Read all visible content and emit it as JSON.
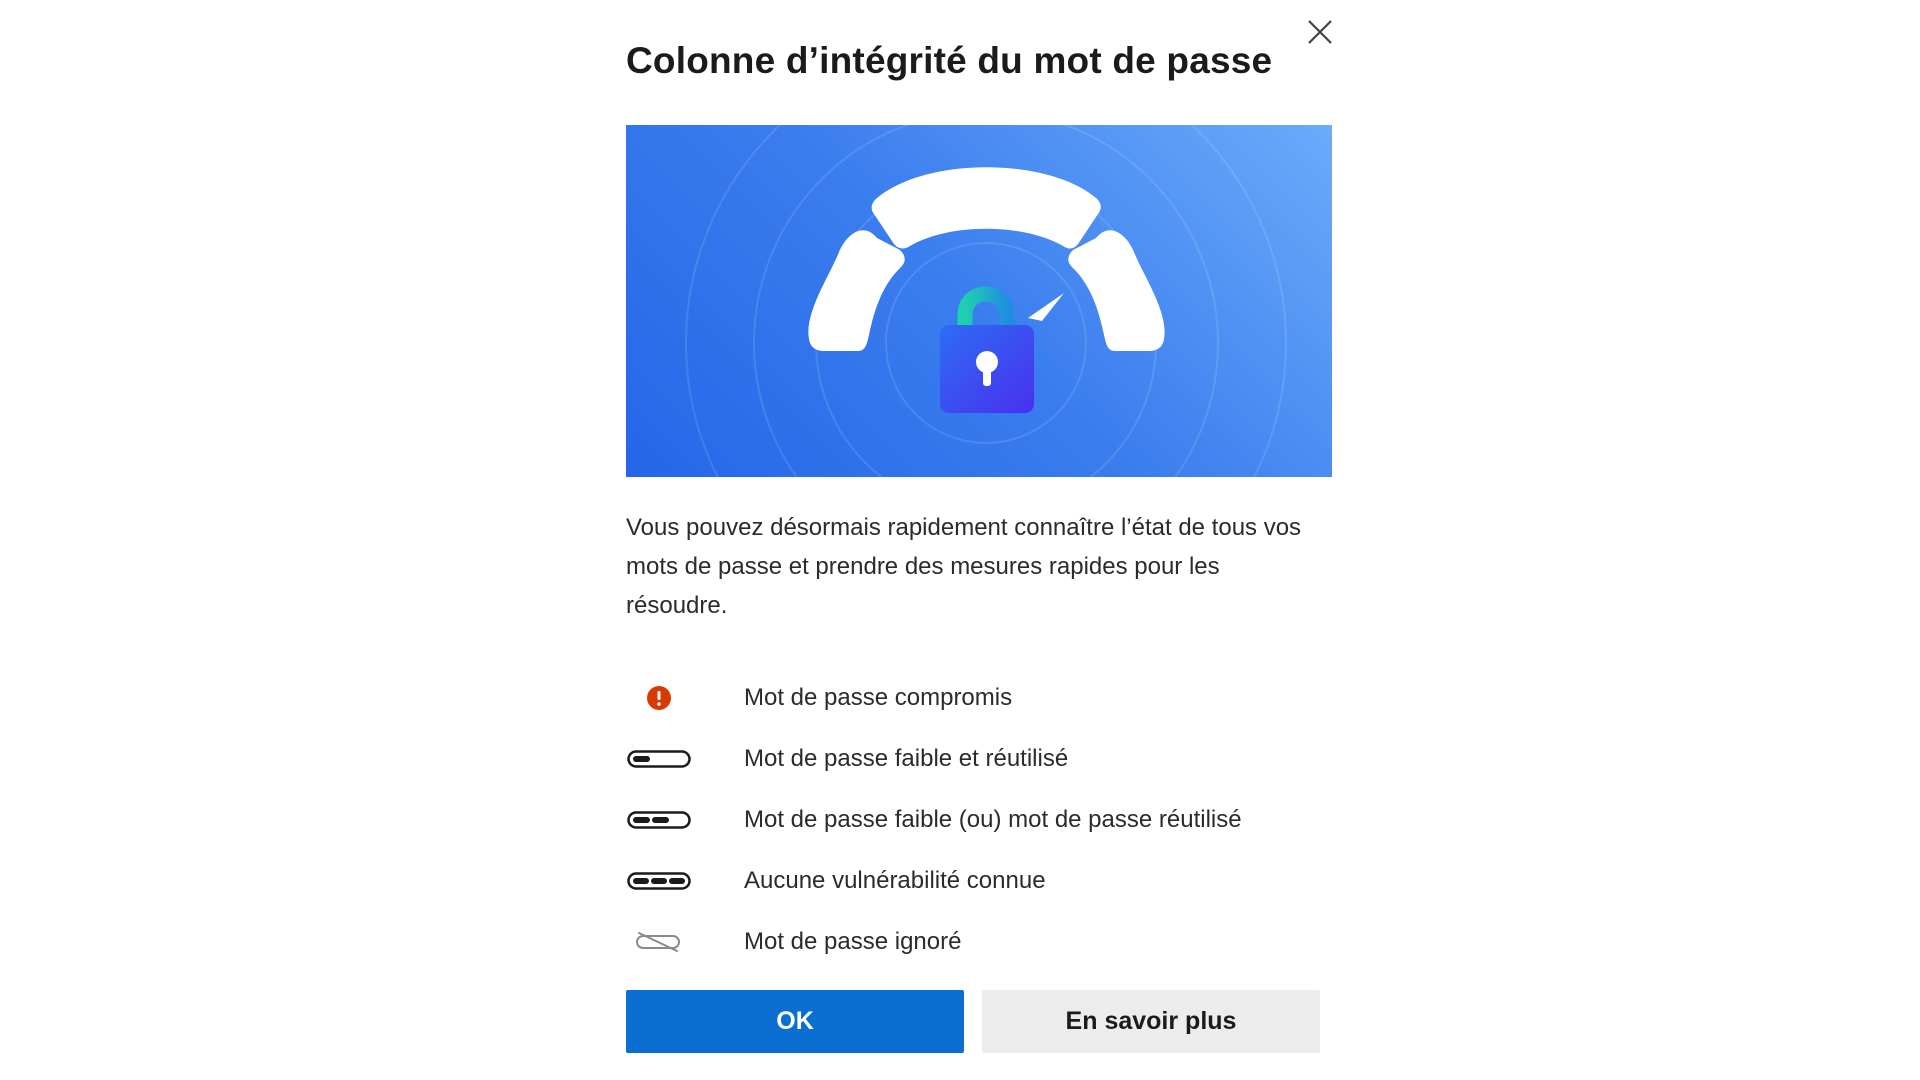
{
  "dialog": {
    "title": "Colonne d’intégrité du mot de passe",
    "description": "Vous pouvez désormais rapidement connaître l’état de tous vos mots de passe et prendre des mesures rapides pour les résoudre.",
    "close_icon": "close-icon",
    "hero_illustration": "padlock-gauge-illustration"
  },
  "legend": {
    "items": [
      {
        "icon": "compromised-alert-icon",
        "label": "Mot de passe compromis",
        "color": "#d83b01"
      },
      {
        "icon": "strength-one-bar-icon",
        "label": "Mot de passe faible et réutilisé",
        "bars_filled": 1,
        "bars_total": 3
      },
      {
        "icon": "strength-two-bars-icon",
        "label": "Mot de passe faible (ou) mot de passe réutilisé",
        "bars_filled": 2,
        "bars_total": 3
      },
      {
        "icon": "strength-three-bars-icon",
        "label": "Aucune vulnérabilité connue",
        "bars_filled": 3,
        "bars_total": 3
      },
      {
        "icon": "ignored-password-icon",
        "label": "Mot de passe ignoré"
      }
    ]
  },
  "actions": {
    "ok_label": "OK",
    "learn_more_label": "En savoir plus"
  },
  "colors": {
    "primary_button": "#0a6fd0",
    "secondary_button": "#ececec",
    "hero_gradient_start": "#2566e8",
    "hero_gradient_end": "#6aabfa",
    "padlock": "#3f3ff0"
  }
}
